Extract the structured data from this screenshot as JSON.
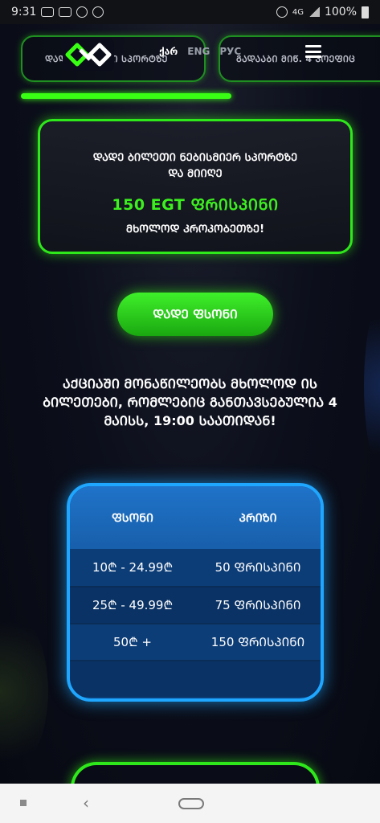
{
  "status_bar": {
    "time": "9:31",
    "notif_badge": "100",
    "network": "4G",
    "battery": "100%"
  },
  "header": {
    "promo_tabs": [
      {
        "label": "ᲓᲐᲓᲔ ᲑᲘᲚᲘᲗᲘ ᲡᲞᲝᲠᲢᲖᲔ"
      },
      {
        "label": "ᲒᲐᲓᲐᲐᲑᲘ ᲛᲘᲬ. 4 ᲙᲝᲔᲤᲘᲪ"
      }
    ],
    "languages": [
      {
        "label": "ქარ",
        "active": true
      },
      {
        "label": "ENG",
        "active": false
      },
      {
        "label": "РУС",
        "active": false
      }
    ]
  },
  "promo": {
    "line1": "ᲓᲐᲓᲔ ᲑᲘᲚᲔᲗᲘ ᲜᲔᲑᲘᲡᲛᲘᲔᲠ ᲡᲞᲝᲠᲢᲖᲔ",
    "line2": "ᲓᲐ ᲛᲘᲘᲦᲔ",
    "amount": "150 EGT ᲤᲠᲘᲡᲞᲘᲜᲘ",
    "sub": "ᲛᲮᲝᲚᲝᲓ ᲙᲠᲝᲙᲝᲑᲔᲗᲖᲔ!"
  },
  "cta": {
    "label": "ᲓᲐᲓᲔ ᲤᲡᲝᲜᲘ"
  },
  "notice": {
    "text": "ᲐᲥᲪᲘᲐᲨᲘ ᲛᲝᲜᲐᲬᲘᲚᲔᲝᲑᲡ ᲛᲮᲝᲚᲝᲓ ᲘᲡ ᲑᲘᲚᲔᲗᲔᲑᲘ, ᲠᲝᲛᲚᲔᲑᲘᲪ ᲒᲐᲜᲗᲐᲕᲡᲔᲑᲣᲚᲘᲐ 4 ᲛᲐᲘᲡᲡ, 19:00 ᲡᲐᲐᲗᲘᲓᲐᲜ!"
  },
  "rates": {
    "headers": [
      "ᲤᲡᲝᲜᲘ",
      "ᲞᲠᲘᲖᲘ"
    ],
    "rows": [
      {
        "stake": "10₾ - 24.99₾",
        "prize": "50 ᲤᲠᲘᲡᲞᲘᲜᲘ"
      },
      {
        "stake": "25₾ - 49.99₾",
        "prize": "75 ᲤᲠᲘᲡᲞᲘᲜᲘ"
      },
      {
        "stake": "50₾ +",
        "prize": "150 ᲤᲠᲘᲡᲞᲘᲜᲘ"
      },
      {
        "stake": "",
        "prize": ""
      }
    ]
  },
  "colors": {
    "accent_green": "#39ff14",
    "card_blue": "#0c3e7a",
    "card_border": "#1fa6ff",
    "background": "#0b0e1a"
  }
}
